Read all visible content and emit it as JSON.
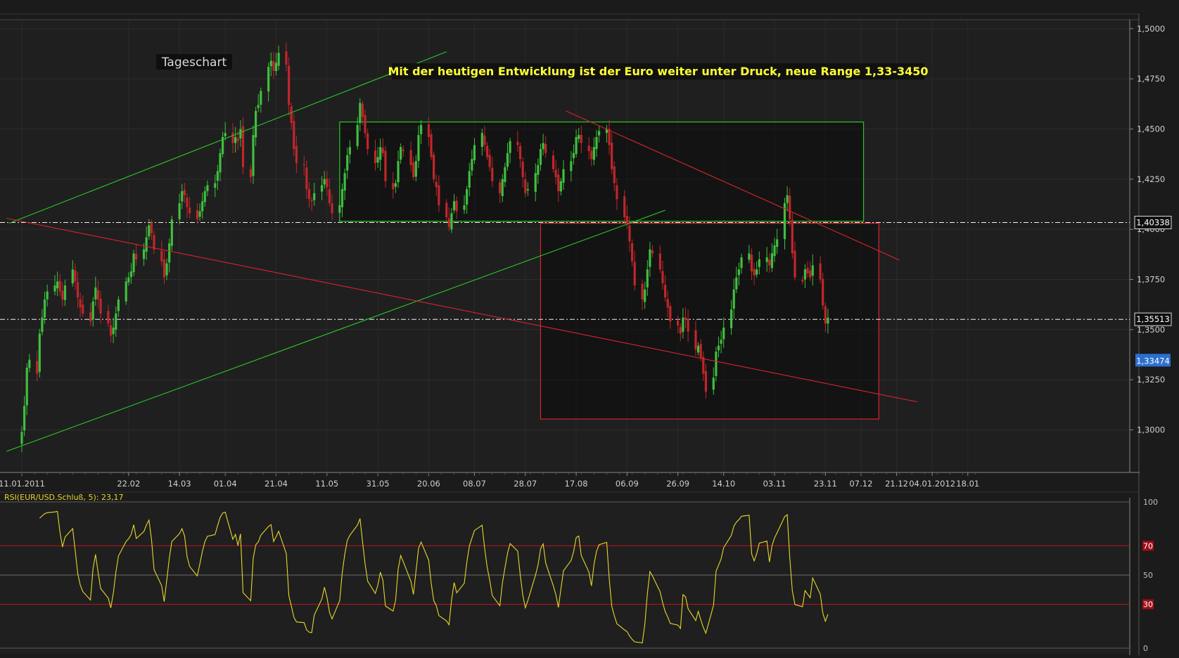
{
  "price_panel": {
    "title": "Tageschart",
    "annotation": "Mit der heutigen Entwicklung ist der Euro weiter unter Druck, neue Range 1,33-3450",
    "level_labels": [
      "1,40338",
      "1,35513"
    ],
    "last_price_label": "1,33474"
  },
  "rsi_panel": {
    "label": "RSI(EUR/USD.Schluß, 5): 23,17"
  },
  "colors": {
    "background": "#1b1b1b",
    "up": "#3fbf3f",
    "down": "#c0262b",
    "green_line": "#27c827",
    "red_line": "#d8242c",
    "rsi": "#e6d72c",
    "rsi_band": "#c0121c",
    "axis_text": "#cfcfcf",
    "annotation_text": "#ffff35",
    "last_price_bg": "#2d6fd0"
  },
  "chart_data": [
    {
      "type": "candlestick",
      "title": "Tageschart",
      "instrument": "EUR/USD",
      "x_ticks": [
        "11.01.2011",
        "22.02",
        "14.03",
        "01.04",
        "21.04",
        "11.05",
        "31.05",
        "20.06",
        "08.07",
        "28.07",
        "17.08",
        "06.09",
        "26.09",
        "14.10",
        "03.11",
        "23.11",
        "07.12",
        "21.12",
        "04.01.2012",
        "18.01"
      ],
      "y_ticks": [
        "1,5000",
        "1,4750",
        "1,4500",
        "1,4250",
        "1,4000",
        "1,3750",
        "1,3500",
        "1,3250",
        "1,3000"
      ],
      "ylim": [
        1.2795,
        1.5045
      ],
      "horizontal_levels": [
        1.40338,
        1.35513
      ],
      "last_price": 1.33474,
      "close_series": {
        "start": "2011-01-11",
        "end": "2011-11-24",
        "values": [
          1.299,
          1.312,
          1.331,
          1.335,
          1.328,
          1.348,
          1.356,
          1.365,
          1.369,
          1.372,
          1.374,
          1.369,
          1.365,
          1.372,
          1.38,
          1.374,
          1.366,
          1.361,
          1.358,
          1.354,
          1.364,
          1.371,
          1.365,
          1.358,
          1.353,
          1.347,
          1.351,
          1.358,
          1.365,
          1.374,
          1.376,
          1.379,
          1.388,
          1.385,
          1.39,
          1.396,
          1.402,
          1.398,
          1.39,
          1.384,
          1.376,
          1.383,
          1.393,
          1.405,
          1.413,
          1.419,
          1.417,
          1.411,
          1.408,
          1.405,
          1.409,
          1.414,
          1.419,
          1.422,
          1.423,
          1.429,
          1.438,
          1.446,
          1.448,
          1.443,
          1.446,
          1.444,
          1.45,
          1.431,
          1.426,
          1.447,
          1.459,
          1.462,
          1.469,
          1.481,
          1.484,
          1.479,
          1.483,
          1.488,
          1.482,
          1.462,
          1.453,
          1.44,
          1.433,
          1.432,
          1.42,
          1.415,
          1.414,
          1.418,
          1.422,
          1.425,
          1.421,
          1.413,
          1.408,
          1.412,
          1.42,
          1.428,
          1.437,
          1.441,
          1.452,
          1.463,
          1.456,
          1.448,
          1.44,
          1.433,
          1.436,
          1.441,
          1.438,
          1.424,
          1.42,
          1.423,
          1.434,
          1.441,
          1.439,
          1.432,
          1.426,
          1.434,
          1.447,
          1.452,
          1.446,
          1.436,
          1.425,
          1.421,
          1.412,
          1.406,
          1.401,
          1.408,
          1.414,
          1.409,
          1.412,
          1.42,
          1.429,
          1.435,
          1.442,
          1.448,
          1.442,
          1.436,
          1.431,
          1.424,
          1.418,
          1.425,
          1.431,
          1.438,
          1.444,
          1.442,
          1.435,
          1.426,
          1.418,
          1.42,
          1.428,
          1.432,
          1.44,
          1.443,
          1.438,
          1.43,
          1.426,
          1.419,
          1.424,
          1.43,
          1.434,
          1.438,
          1.446,
          1.447,
          1.443,
          1.439,
          1.435,
          1.441,
          1.446,
          1.449,
          1.45,
          1.442,
          1.43,
          1.423,
          1.415,
          1.406,
          1.403,
          1.394,
          1.384,
          1.372,
          1.365,
          1.37,
          1.38,
          1.39,
          1.388,
          1.38,
          1.373,
          1.366,
          1.361,
          1.354,
          1.352,
          1.348,
          1.356,
          1.355,
          1.349,
          1.34,
          1.342,
          1.336,
          1.328,
          1.319,
          1.326,
          1.339,
          1.342,
          1.345,
          1.351,
          1.36,
          1.37,
          1.376,
          1.38,
          1.386,
          1.388,
          1.379,
          1.377,
          1.38,
          1.385,
          1.386,
          1.382,
          1.388,
          1.392,
          1.395,
          1.413,
          1.417,
          1.405,
          1.388,
          1.376,
          1.374,
          1.38,
          1.378,
          1.376,
          1.382,
          1.375,
          1.362,
          1.353,
          1.356,
          1.352,
          1.349,
          1.345,
          1.347,
          1.35,
          1.346,
          1.341,
          1.3347
        ]
      },
      "trendlines": [
        {
          "color": "green",
          "from": [
            "2011-01-06",
            1.403
          ],
          "to": [
            "2011-06-27",
            1.4885
          ]
        },
        {
          "color": "green",
          "from": [
            "2011-01-05",
            1.2893
          ],
          "to": [
            "2011-09-21",
            1.4095
          ]
        },
        {
          "color": "red",
          "from": [
            "2011-01-05",
            1.4055
          ],
          "to": [
            "2011-12-29",
            1.314
          ]
        },
        {
          "color": "red",
          "from": [
            "2011-08-13",
            1.459
          ],
          "to": [
            "2011-12-22",
            1.3847
          ]
        }
      ],
      "range_boxes": [
        {
          "color": "green",
          "x_from": "2011-05-16",
          "x_to": "2011-12-08",
          "y_from": 1.404,
          "y_to": 1.4535
        },
        {
          "color": "red",
          "x_from": "2011-08-03",
          "x_to": "2011-12-14",
          "y_from": 1.3054,
          "y_to": 1.403
        }
      ]
    },
    {
      "type": "line",
      "title": "RSI(EUR/USD.Schluß, 5): 23,17",
      "y_ticks": [
        "100",
        "70",
        "50",
        "30",
        "0"
      ],
      "ylim": [
        0,
        100
      ],
      "reference_levels": [
        70,
        50,
        30
      ],
      "last_value": 23.17
    }
  ]
}
